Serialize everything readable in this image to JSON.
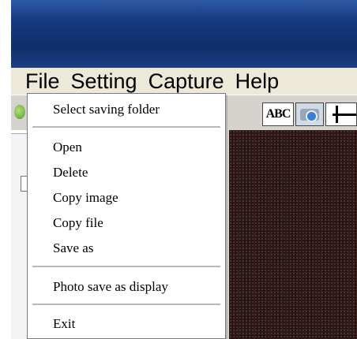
{
  "menubar": {
    "items": [
      "File",
      "Setting",
      "Capture",
      "Help"
    ]
  },
  "toolbar": {
    "text_button_label": "ABC",
    "icons": [
      "app-icon",
      "text-icon",
      "camera-icon",
      "crosshair-icon"
    ]
  },
  "file_menu": {
    "items": [
      "Select saving folder",
      "Open",
      "Delete",
      "Copy image",
      "Copy file",
      "Save as",
      "Photo save as display",
      "Exit"
    ]
  },
  "colors": {
    "titlebar": "#16397f",
    "menubar": "#ece9d8",
    "window": "#d6d3ce",
    "image": "#2a1a1a"
  }
}
